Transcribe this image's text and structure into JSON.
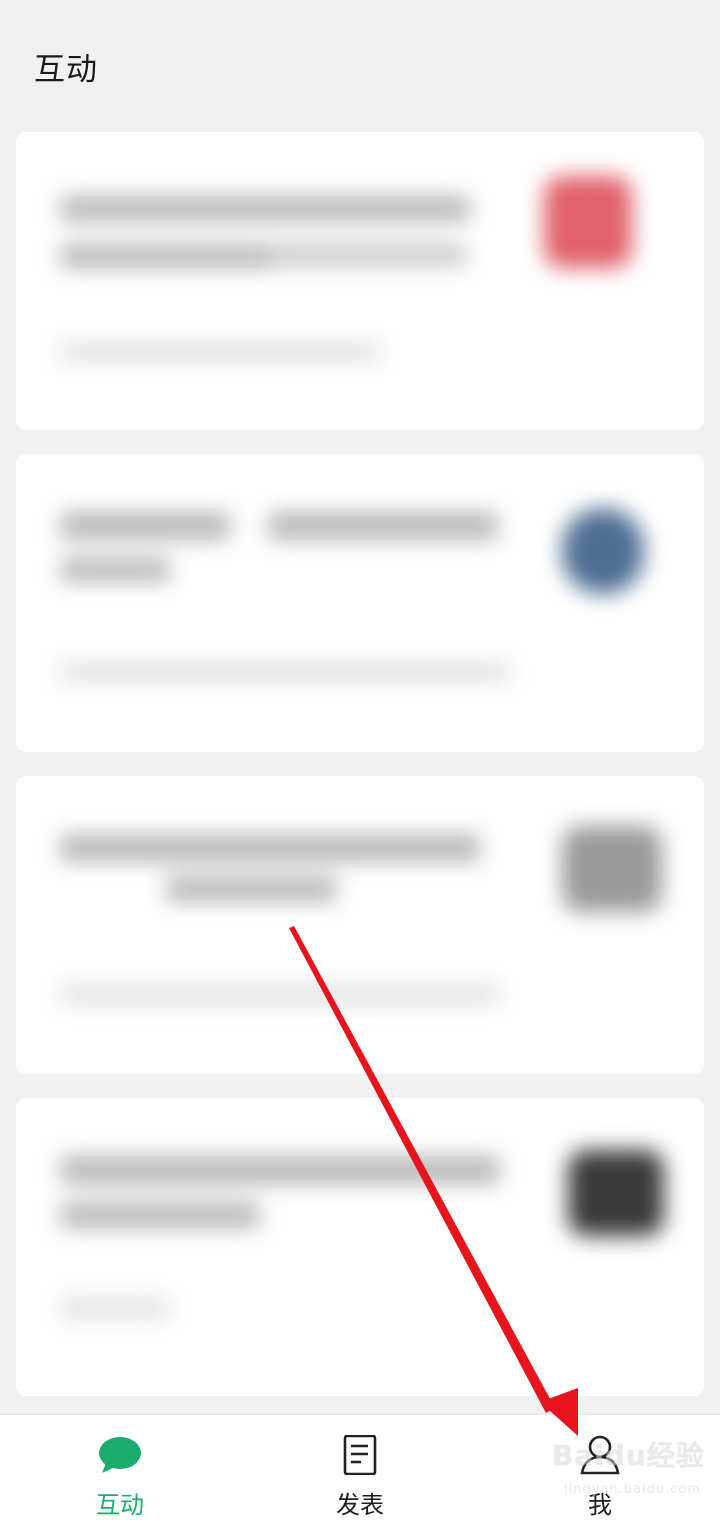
{
  "header": {
    "title": "互动"
  },
  "tabbar": {
    "tabs": [
      {
        "label": "互动",
        "icon": "chat-bubble-icon",
        "active": true
      },
      {
        "label": "发表",
        "icon": "document-icon",
        "active": false
      },
      {
        "label": "我",
        "icon": "person-icon",
        "active": false
      }
    ],
    "active_color": "#1aad6b"
  },
  "watermark": {
    "text": "Baidu经验",
    "subtext": "jingyan.baidu.com"
  },
  "colors": {
    "accent": "#1aad6b",
    "annotation": "#e8141b"
  }
}
